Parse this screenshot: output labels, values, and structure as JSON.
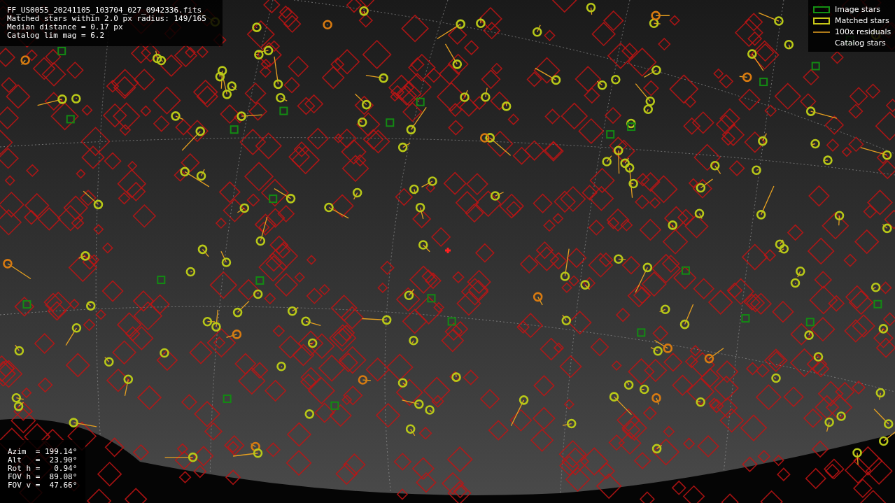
{
  "header_info": {
    "lines": [
      "FF_US0055_20241105_103704_027_0942336.fits",
      "Matched stars within 2.0 px radius: 149/165",
      "Median distance = 0.17 px",
      "Catalog lim mag = 6.2"
    ]
  },
  "legend": {
    "items": [
      {
        "kind": "image",
        "label": "Image stars"
      },
      {
        "kind": "matched",
        "label": "Matched stars"
      },
      {
        "kind": "residual",
        "label": "100x residuals"
      },
      {
        "kind": "catalog",
        "label": "Catalog stars"
      }
    ]
  },
  "pointing_info": {
    "lines": [
      "Azim  = 199.14°",
      "Alt   =  23.90°",
      "Rot h =   0.94°",
      "FOV h =  89.08°",
      "FOV v =  47.66°"
    ]
  }
}
